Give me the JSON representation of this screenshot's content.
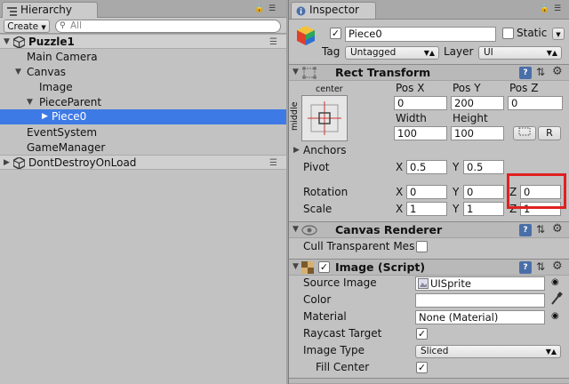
{
  "hierarchy": {
    "tab_label": "Hierarchy",
    "create_label": "Create",
    "search_placeholder": "All",
    "items": [
      {
        "label": "Puzzle1",
        "kind": "scene"
      },
      {
        "label": "Main Camera"
      },
      {
        "label": "Canvas"
      },
      {
        "label": "Image"
      },
      {
        "label": "PieceParent"
      },
      {
        "label": "Piece0",
        "selected": true
      },
      {
        "label": "EventSystem"
      },
      {
        "label": "GameManager"
      },
      {
        "label": "DontDestroyOnLoad",
        "kind": "scene"
      }
    ]
  },
  "inspector": {
    "tab_label": "Inspector",
    "object_name": "Piece0",
    "static_label": "Static",
    "tag_label": "Tag",
    "tag_value": "Untagged",
    "layer_label": "Layer",
    "layer_value": "UI",
    "rect_transform": {
      "title": "Rect Transform",
      "anchor_h": "center",
      "anchor_v": "middle",
      "pos_x_label": "Pos X",
      "pos_y_label": "Pos Y",
      "pos_z_label": "Pos Z",
      "pos_x": "0",
      "pos_y": "200",
      "pos_z": "0",
      "width_label": "Width",
      "height_label": "Height",
      "width": "100",
      "height": "100",
      "r_button": "R",
      "anchors_label": "Anchors",
      "pivot_label": "Pivot",
      "pivot_x": "0.5",
      "pivot_y": "0.5",
      "rotation_label": "Rotation",
      "rot_x": "0",
      "rot_y": "0",
      "rot_z": "0",
      "scale_label": "Scale",
      "scale_x": "1",
      "scale_y": "1",
      "scale_z": "1",
      "x": "X",
      "y": "Y",
      "z": "Z"
    },
    "canvas_renderer": {
      "title": "Canvas Renderer",
      "cull_label": "Cull Transparent Mes"
    },
    "image": {
      "title": "Image (Script)",
      "source_label": "Source Image",
      "source_value": "UISprite",
      "color_label": "Color",
      "material_label": "Material",
      "material_value": "None (Material)",
      "raycast_label": "Raycast Target",
      "type_label": "Image Type",
      "type_value": "Sliced",
      "fill_label": "Fill Center"
    }
  },
  "colors": {
    "selection": "#3e7ae6",
    "highlight_box": "#e02020"
  }
}
